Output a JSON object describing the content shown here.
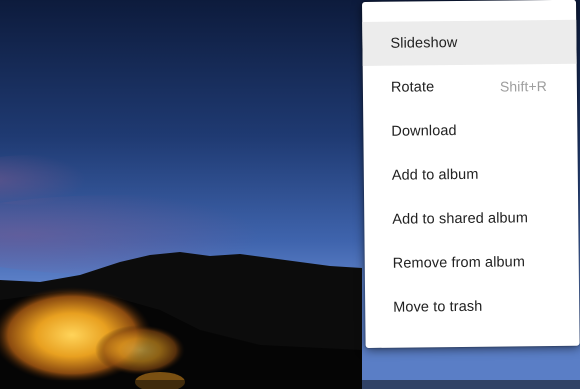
{
  "menu": {
    "items": [
      {
        "label": "Slideshow",
        "shortcut": "",
        "highlighted": true
      },
      {
        "label": "Rotate",
        "shortcut": "Shift+R",
        "highlighted": false
      },
      {
        "label": "Download",
        "shortcut": "",
        "highlighted": false
      },
      {
        "label": "Add to album",
        "shortcut": "",
        "highlighted": false
      },
      {
        "label": "Add to shared album",
        "shortcut": "",
        "highlighted": false
      },
      {
        "label": "Remove from album",
        "shortcut": "",
        "highlighted": false
      },
      {
        "label": "Move to trash",
        "shortcut": "",
        "highlighted": false
      }
    ]
  },
  "colors": {
    "sky_top": "#0c1a3a",
    "sky_mid": "#2d4f8c",
    "sky_horizon": "#5b7fc4",
    "mountain": "#0b0b0b",
    "glow": "#e9a21e",
    "highlight": "#ececec"
  }
}
